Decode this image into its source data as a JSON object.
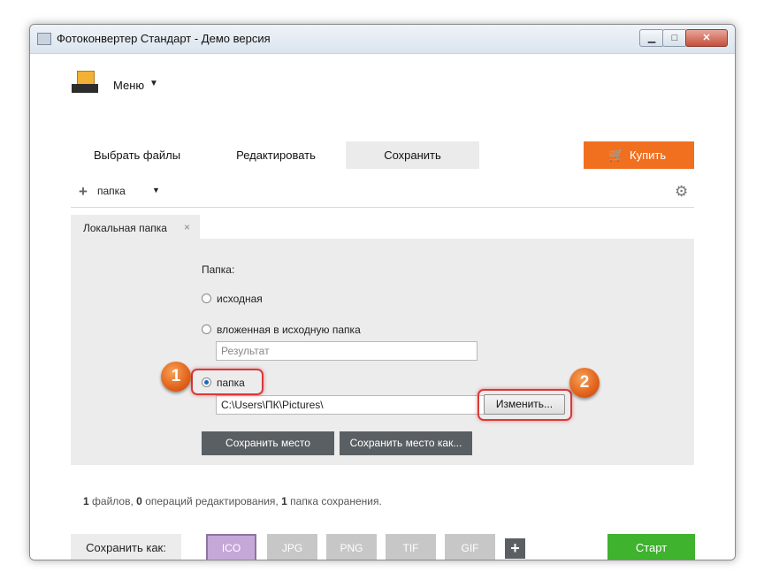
{
  "window": {
    "title": "Фотоконвертер Стандарт - Демо версия",
    "controls": {
      "minimize": "▁",
      "maximize": "□",
      "close": "✕"
    }
  },
  "menu": {
    "label": "Меню",
    "caret": "▼"
  },
  "tabs": [
    {
      "label": "Выбрать файлы",
      "active": false
    },
    {
      "label": "Редактировать",
      "active": false
    },
    {
      "label": "Сохранить",
      "active": true
    }
  ],
  "buy": {
    "label": "Купить",
    "icon": "cart-icon",
    "color": "#f07020"
  },
  "destination_bar": {
    "add_icon": "plus-icon",
    "label": "папка",
    "caret": "▼",
    "settings_icon": "gear-icon"
  },
  "local_folder_tab": {
    "label": "Локальная папка",
    "close": "×"
  },
  "folder_settings": {
    "heading": "Папка:",
    "options": [
      {
        "label": "исходная",
        "selected": false
      },
      {
        "label": "вложенная в исходную папка",
        "selected": false
      },
      {
        "label": "папка",
        "selected": true
      }
    ],
    "subfolder_placeholder": "Результат",
    "path": "C:\\Users\\ПК\\Pictures\\",
    "change_button": "Изменить...",
    "save_location_button": "Сохранить место",
    "save_location_as_button": "Сохранить место как..."
  },
  "callouts": [
    {
      "number": "1"
    },
    {
      "number": "2"
    }
  ],
  "status": {
    "files_count": "1",
    "files_text": "файлов,",
    "ops_count": "0",
    "ops_text": "операций редактирования,",
    "folders_count": "1",
    "folders_text": "папка сохранения."
  },
  "save_as": {
    "label": "Сохранить как:",
    "formats": [
      {
        "label": "ICO",
        "active": true
      },
      {
        "label": "JPG",
        "active": false
      },
      {
        "label": "PNG",
        "active": false
      },
      {
        "label": "TIF",
        "active": false
      },
      {
        "label": "GIF",
        "active": false
      }
    ],
    "add_icon": "plus-icon"
  },
  "start": {
    "label": "Старт",
    "color": "#3fb22e"
  }
}
